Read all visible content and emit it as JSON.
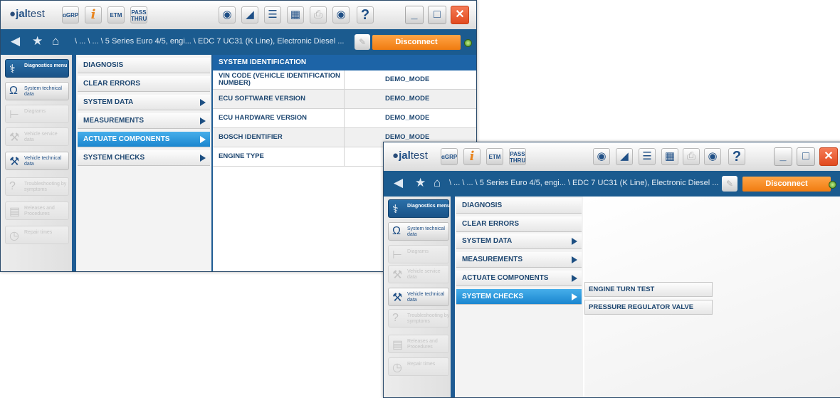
{
  "app": {
    "logo_prefix": "●",
    "logo_brand": "jal",
    "logo_suffix": "test",
    "toolbar": {
      "grp_label": "ɑGRP",
      "info_label": "i",
      "etm_label": "ETM",
      "pass_label_1": "PASS",
      "pass_label_2": "THRU"
    },
    "window_buttons": {
      "minimize": "_",
      "maximize": "□",
      "close": "✕"
    }
  },
  "nav": {
    "path": "\\ ... \\ ... \\ 5 Series Euro 4/5, engi...  \\ EDC 7 UC31 (K Line), Electronic Diesel ...",
    "disconnect_label": "Disconnect"
  },
  "sidebar": {
    "items": [
      {
        "label": "Diagnostics menu",
        "icon": "stethoscope-icon",
        "state": "active"
      },
      {
        "label": "System technical data",
        "icon": "omega-icon",
        "state": "normal"
      },
      {
        "label": "Diagrams",
        "icon": "diagram-icon",
        "state": "disabled"
      },
      {
        "label": "Vehicle service data",
        "icon": "wrench-icon",
        "state": "disabled"
      },
      {
        "label": "Vehicle technical data",
        "icon": "car-wrench-icon",
        "state": "normal"
      },
      {
        "label": "Troubleshooting by symptoms",
        "icon": "troubleshoot-icon",
        "state": "disabled"
      },
      {
        "label": "Releases and Procedures",
        "icon": "document-icon",
        "state": "disabled"
      },
      {
        "label": "Repair times",
        "icon": "clock-icon",
        "state": "disabled"
      }
    ]
  },
  "menu": {
    "items": [
      {
        "label": "DIAGNOSIS",
        "has_submenu": false
      },
      {
        "label": "CLEAR ERRORS",
        "has_submenu": false
      },
      {
        "label": "SYSTEM DATA",
        "has_submenu": true
      },
      {
        "label": "MEASUREMENTS",
        "has_submenu": true
      },
      {
        "label": "ACTUATE COMPONENTS",
        "has_submenu": true
      },
      {
        "label": "SYSTEM CHECKS",
        "has_submenu": true
      }
    ]
  },
  "window1": {
    "selected_menu": "ACTUATE COMPONENTS",
    "table": {
      "header": "SYSTEM IDENTIFICATION",
      "rows": [
        {
          "key": "VIN CODE (VEHICLE IDENTIFICATION NUMBER)",
          "value": "DEMO_MODE"
        },
        {
          "key": "ECU SOFTWARE VERSION",
          "value": "DEMO_MODE"
        },
        {
          "key": "ECU HARDWARE VERSION",
          "value": "DEMO_MODE"
        },
        {
          "key": "BOSCH IDENTIFIER",
          "value": "DEMO_MODE"
        },
        {
          "key": "ENGINE TYPE",
          "value": ""
        }
      ]
    }
  },
  "window2": {
    "selected_menu": "SYSTEM CHECKS",
    "submenu": [
      "ENGINE TURN TEST",
      "PRESSURE REGULATOR VALVE"
    ]
  },
  "colors": {
    "accent": "#1b5b8f",
    "selection": "#1b86cf",
    "disconnect": "#f07b10",
    "close": "#e14a1f"
  }
}
